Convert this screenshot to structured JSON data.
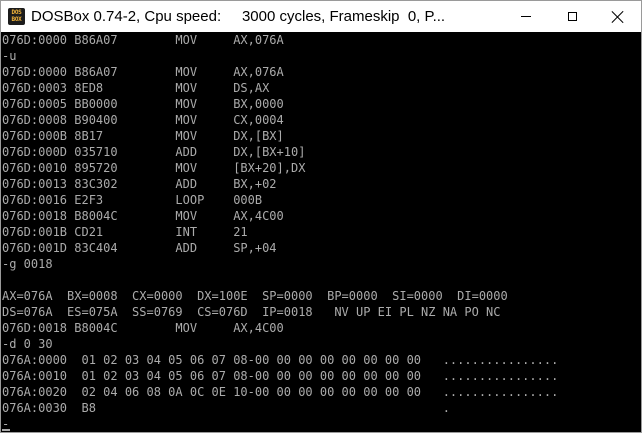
{
  "window": {
    "title": "DOSBox 0.74-2, Cpu speed:     3000 cycles, Frameskip  0, P...",
    "icon_label_line1": "DOS",
    "icon_label_line2": "BOX",
    "controls": [
      "minimize-icon",
      "maximize-icon",
      "close-icon"
    ]
  },
  "colors": {
    "console_background": "#000000",
    "console_text": "#ababab",
    "titlebar_background": "#ffffff"
  },
  "console": {
    "lines": [
      "076D:0000 B86A07        MOV     AX,076A",
      "-u",
      "076D:0000 B86A07        MOV     AX,076A",
      "076D:0003 8ED8          MOV     DS,AX",
      "076D:0005 BB0000        MOV     BX,0000",
      "076D:0008 B90400        MOV     CX,0004",
      "076D:000B 8B17          MOV     DX,[BX]",
      "076D:000D 035710        ADD     DX,[BX+10]",
      "076D:0010 895720        MOV     [BX+20],DX",
      "076D:0013 83C302        ADD     BX,+02",
      "076D:0016 E2F3          LOOP    000B",
      "076D:0018 B8004C        MOV     AX,4C00",
      "076D:001B CD21          INT     21",
      "076D:001D 83C404        ADD     SP,+04",
      "-g 0018",
      "",
      "AX=076A  BX=0008  CX=0000  DX=100E  SP=0000  BP=0000  SI=0000  DI=0000",
      "DS=076A  ES=075A  SS=0769  CS=076D  IP=0018   NV UP EI PL NZ NA PO NC",
      "076D:0018 B8004C        MOV     AX,4C00",
      "-d 0 30",
      "076A:0000  01 02 03 04 05 06 07 08-00 00 00 00 00 00 00 00   ................",
      "076A:0010  01 02 03 04 05 06 07 08-00 00 00 00 00 00 00 00   ................",
      "076A:0020  02 04 06 08 0A 0C 0E 10-00 00 00 00 00 00 00 00   ................",
      "076A:0030  B8                                                .",
      "-"
    ]
  }
}
